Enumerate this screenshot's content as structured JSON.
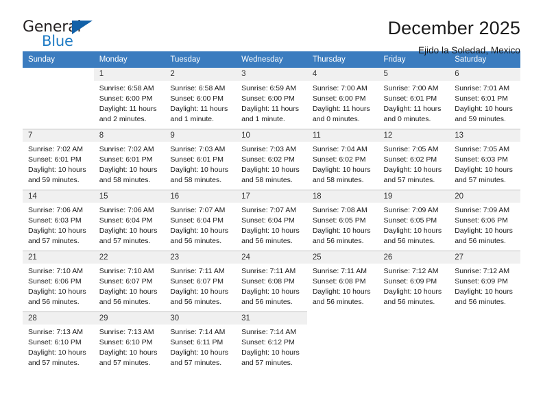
{
  "brand": {
    "name_part1": "General",
    "name_part2": "Blue",
    "logo_icon": "triangle-logo-icon"
  },
  "header": {
    "title": "December 2025",
    "subtitle": "Ejido la Soledad, Mexico"
  },
  "colors": {
    "header_row_bg": "#3b7cbf",
    "daynum_bg": "#f0f0f0",
    "brand_blue": "#1e7bc4",
    "grid_line": "#bfbfbf"
  },
  "weekday_headers": [
    "Sunday",
    "Monday",
    "Tuesday",
    "Wednesday",
    "Thursday",
    "Friday",
    "Saturday"
  ],
  "weeks": [
    [
      {
        "day": "",
        "sunrise": "",
        "sunset": "",
        "daylight1": "",
        "daylight2": ""
      },
      {
        "day": "1",
        "sunrise": "Sunrise: 6:58 AM",
        "sunset": "Sunset: 6:00 PM",
        "daylight1": "Daylight: 11 hours",
        "daylight2": "and 2 minutes."
      },
      {
        "day": "2",
        "sunrise": "Sunrise: 6:58 AM",
        "sunset": "Sunset: 6:00 PM",
        "daylight1": "Daylight: 11 hours",
        "daylight2": "and 1 minute."
      },
      {
        "day": "3",
        "sunrise": "Sunrise: 6:59 AM",
        "sunset": "Sunset: 6:00 PM",
        "daylight1": "Daylight: 11 hours",
        "daylight2": "and 1 minute."
      },
      {
        "day": "4",
        "sunrise": "Sunrise: 7:00 AM",
        "sunset": "Sunset: 6:00 PM",
        "daylight1": "Daylight: 11 hours",
        "daylight2": "and 0 minutes."
      },
      {
        "day": "5",
        "sunrise": "Sunrise: 7:00 AM",
        "sunset": "Sunset: 6:01 PM",
        "daylight1": "Daylight: 11 hours",
        "daylight2": "and 0 minutes."
      },
      {
        "day": "6",
        "sunrise": "Sunrise: 7:01 AM",
        "sunset": "Sunset: 6:01 PM",
        "daylight1": "Daylight: 10 hours",
        "daylight2": "and 59 minutes."
      }
    ],
    [
      {
        "day": "7",
        "sunrise": "Sunrise: 7:02 AM",
        "sunset": "Sunset: 6:01 PM",
        "daylight1": "Daylight: 10 hours",
        "daylight2": "and 59 minutes."
      },
      {
        "day": "8",
        "sunrise": "Sunrise: 7:02 AM",
        "sunset": "Sunset: 6:01 PM",
        "daylight1": "Daylight: 10 hours",
        "daylight2": "and 58 minutes."
      },
      {
        "day": "9",
        "sunrise": "Sunrise: 7:03 AM",
        "sunset": "Sunset: 6:01 PM",
        "daylight1": "Daylight: 10 hours",
        "daylight2": "and 58 minutes."
      },
      {
        "day": "10",
        "sunrise": "Sunrise: 7:03 AM",
        "sunset": "Sunset: 6:02 PM",
        "daylight1": "Daylight: 10 hours",
        "daylight2": "and 58 minutes."
      },
      {
        "day": "11",
        "sunrise": "Sunrise: 7:04 AM",
        "sunset": "Sunset: 6:02 PM",
        "daylight1": "Daylight: 10 hours",
        "daylight2": "and 58 minutes."
      },
      {
        "day": "12",
        "sunrise": "Sunrise: 7:05 AM",
        "sunset": "Sunset: 6:02 PM",
        "daylight1": "Daylight: 10 hours",
        "daylight2": "and 57 minutes."
      },
      {
        "day": "13",
        "sunrise": "Sunrise: 7:05 AM",
        "sunset": "Sunset: 6:03 PM",
        "daylight1": "Daylight: 10 hours",
        "daylight2": "and 57 minutes."
      }
    ],
    [
      {
        "day": "14",
        "sunrise": "Sunrise: 7:06 AM",
        "sunset": "Sunset: 6:03 PM",
        "daylight1": "Daylight: 10 hours",
        "daylight2": "and 57 minutes."
      },
      {
        "day": "15",
        "sunrise": "Sunrise: 7:06 AM",
        "sunset": "Sunset: 6:04 PM",
        "daylight1": "Daylight: 10 hours",
        "daylight2": "and 57 minutes."
      },
      {
        "day": "16",
        "sunrise": "Sunrise: 7:07 AM",
        "sunset": "Sunset: 6:04 PM",
        "daylight1": "Daylight: 10 hours",
        "daylight2": "and 56 minutes."
      },
      {
        "day": "17",
        "sunrise": "Sunrise: 7:07 AM",
        "sunset": "Sunset: 6:04 PM",
        "daylight1": "Daylight: 10 hours",
        "daylight2": "and 56 minutes."
      },
      {
        "day": "18",
        "sunrise": "Sunrise: 7:08 AM",
        "sunset": "Sunset: 6:05 PM",
        "daylight1": "Daylight: 10 hours",
        "daylight2": "and 56 minutes."
      },
      {
        "day": "19",
        "sunrise": "Sunrise: 7:09 AM",
        "sunset": "Sunset: 6:05 PM",
        "daylight1": "Daylight: 10 hours",
        "daylight2": "and 56 minutes."
      },
      {
        "day": "20",
        "sunrise": "Sunrise: 7:09 AM",
        "sunset": "Sunset: 6:06 PM",
        "daylight1": "Daylight: 10 hours",
        "daylight2": "and 56 minutes."
      }
    ],
    [
      {
        "day": "21",
        "sunrise": "Sunrise: 7:10 AM",
        "sunset": "Sunset: 6:06 PM",
        "daylight1": "Daylight: 10 hours",
        "daylight2": "and 56 minutes."
      },
      {
        "day": "22",
        "sunrise": "Sunrise: 7:10 AM",
        "sunset": "Sunset: 6:07 PM",
        "daylight1": "Daylight: 10 hours",
        "daylight2": "and 56 minutes."
      },
      {
        "day": "23",
        "sunrise": "Sunrise: 7:11 AM",
        "sunset": "Sunset: 6:07 PM",
        "daylight1": "Daylight: 10 hours",
        "daylight2": "and 56 minutes."
      },
      {
        "day": "24",
        "sunrise": "Sunrise: 7:11 AM",
        "sunset": "Sunset: 6:08 PM",
        "daylight1": "Daylight: 10 hours",
        "daylight2": "and 56 minutes."
      },
      {
        "day": "25",
        "sunrise": "Sunrise: 7:11 AM",
        "sunset": "Sunset: 6:08 PM",
        "daylight1": "Daylight: 10 hours",
        "daylight2": "and 56 minutes."
      },
      {
        "day": "26",
        "sunrise": "Sunrise: 7:12 AM",
        "sunset": "Sunset: 6:09 PM",
        "daylight1": "Daylight: 10 hours",
        "daylight2": "and 56 minutes."
      },
      {
        "day": "27",
        "sunrise": "Sunrise: 7:12 AM",
        "sunset": "Sunset: 6:09 PM",
        "daylight1": "Daylight: 10 hours",
        "daylight2": "and 56 minutes."
      }
    ],
    [
      {
        "day": "28",
        "sunrise": "Sunrise: 7:13 AM",
        "sunset": "Sunset: 6:10 PM",
        "daylight1": "Daylight: 10 hours",
        "daylight2": "and 57 minutes."
      },
      {
        "day": "29",
        "sunrise": "Sunrise: 7:13 AM",
        "sunset": "Sunset: 6:10 PM",
        "daylight1": "Daylight: 10 hours",
        "daylight2": "and 57 minutes."
      },
      {
        "day": "30",
        "sunrise": "Sunrise: 7:14 AM",
        "sunset": "Sunset: 6:11 PM",
        "daylight1": "Daylight: 10 hours",
        "daylight2": "and 57 minutes."
      },
      {
        "day": "31",
        "sunrise": "Sunrise: 7:14 AM",
        "sunset": "Sunset: 6:12 PM",
        "daylight1": "Daylight: 10 hours",
        "daylight2": "and 57 minutes."
      },
      {
        "day": "",
        "sunrise": "",
        "sunset": "",
        "daylight1": "",
        "daylight2": ""
      },
      {
        "day": "",
        "sunrise": "",
        "sunset": "",
        "daylight1": "",
        "daylight2": ""
      },
      {
        "day": "",
        "sunrise": "",
        "sunset": "",
        "daylight1": "",
        "daylight2": ""
      }
    ]
  ]
}
